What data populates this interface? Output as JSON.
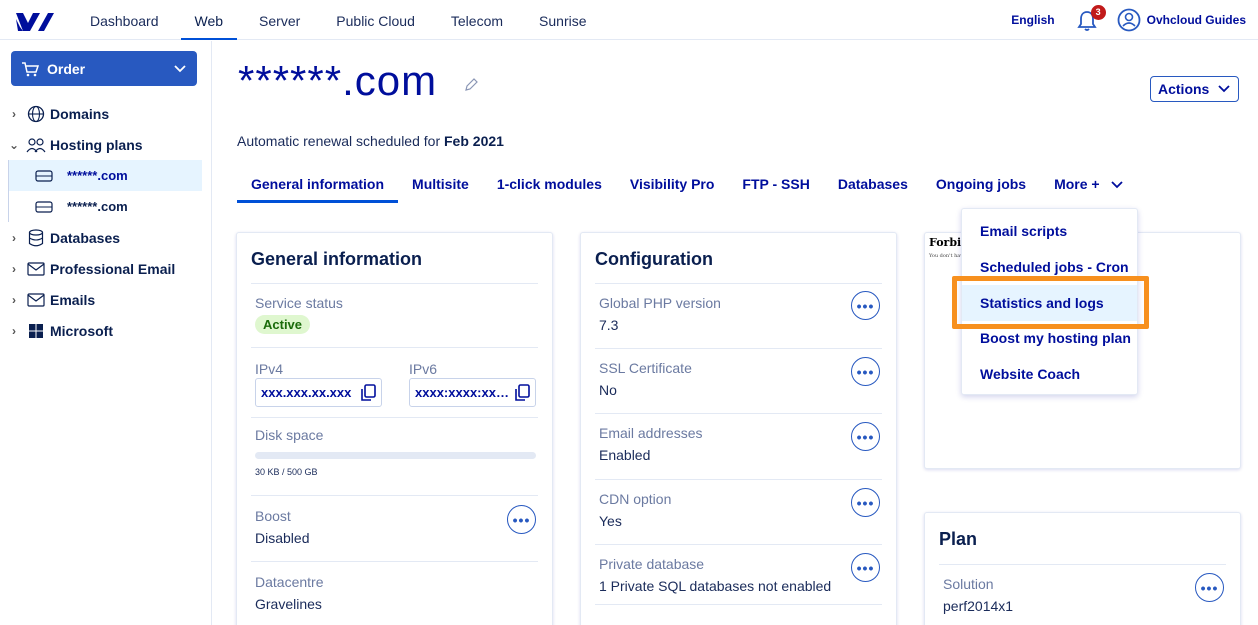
{
  "topbar": {
    "nav": [
      "Dashboard",
      "Web",
      "Server",
      "Public Cloud",
      "Telecom",
      "Sunrise"
    ],
    "active_nav": "Web",
    "language": "English",
    "notification_count": "3",
    "guides_label": "Ovhcloud Guides"
  },
  "sidebar": {
    "order_label": "Order",
    "items": [
      {
        "label": "Domains"
      },
      {
        "label": "Hosting plans"
      },
      {
        "label": "******.com"
      },
      {
        "label": "******.com"
      },
      {
        "label": "Databases"
      },
      {
        "label": "Professional Email"
      },
      {
        "label": "Emails"
      },
      {
        "label": "Microsoft"
      }
    ]
  },
  "header": {
    "domain": "******.com",
    "actions_label": "Actions",
    "renewal_prefix": "Automatic renewal scheduled for",
    "renewal_date": "Feb 2021"
  },
  "tabs": [
    "General information",
    "Multisite",
    "1-click modules",
    "Visibility Pro",
    "FTP - SSH",
    "Databases",
    "Ongoing jobs",
    "More +"
  ],
  "more_menu": [
    "Email scripts",
    "Scheduled jobs - Cron",
    "Statistics and logs",
    "Boost my hosting plan",
    "Website Coach"
  ],
  "general_info": {
    "title": "General information",
    "service_status_label": "Service status",
    "service_status": "Active",
    "ipv4_label": "IPv4",
    "ipv4": "xxx.xxx.xx.xxx",
    "ipv6_label": "IPv6",
    "ipv6": "xxxx:xxxx:xxxx:xxxx",
    "disk_label": "Disk space",
    "disk_usage": "30 KB / 500 GB",
    "disk_used_fraction": 0.0,
    "boost_label": "Boost",
    "boost": "Disabled",
    "datacentre_label": "Datacentre",
    "datacentre": "Gravelines"
  },
  "configuration": {
    "title": "Configuration",
    "php_label": "Global PHP version",
    "php": "7.3",
    "ssl_label": "SSL Certificate",
    "ssl": "No",
    "email_label": "Email addresses",
    "email": "Enabled",
    "cdn_label": "CDN option",
    "cdn": "Yes",
    "privdb_label": "Private database",
    "privdb": "1 Private SQL databases not enabled"
  },
  "preview": {
    "title": "Forbidden",
    "subtitle": "You don't have permission to access this resource."
  },
  "plan": {
    "title": "Plan",
    "solution_label": "Solution",
    "solution": "perf2014x1"
  }
}
